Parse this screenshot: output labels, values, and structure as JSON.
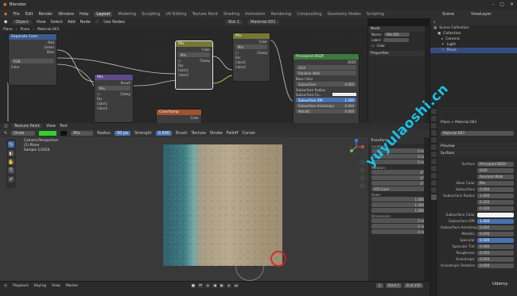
{
  "window": {
    "title": "Blender"
  },
  "menu": [
    "File",
    "Edit",
    "Render",
    "Window",
    "Help"
  ],
  "workspaces": [
    {
      "label": "Layout",
      "active": true
    },
    {
      "label": "Modeling"
    },
    {
      "label": "Sculpting"
    },
    {
      "label": "UV Editing"
    },
    {
      "label": "Texture Paint"
    },
    {
      "label": "Shading"
    },
    {
      "label": "Animation"
    },
    {
      "label": "Rendering"
    },
    {
      "label": "Compositing"
    },
    {
      "label": "Geometry Nodes"
    },
    {
      "label": "Scripting"
    }
  ],
  "top_right": {
    "scene": "Scene",
    "view_layer": "ViewLayer"
  },
  "node_header": {
    "object_mode": "Object",
    "view": "View",
    "select": "Select",
    "add": "Add",
    "node": "Node",
    "use_nodes": "Use Nodes",
    "slot": "Slot 1",
    "material": "Material.001"
  },
  "breadcrumb": {
    "obj": "Plane",
    "mesh": "Plane",
    "mat": "Material.003"
  },
  "nodes": {
    "separate_color": {
      "title": "Separate Color",
      "outputs": [
        "Red",
        "Green",
        "Blue"
      ],
      "mode": "RGB",
      "input": "Color"
    },
    "mix1": {
      "title": "Mix",
      "output": "Result",
      "type": "Mix",
      "clamp": "Clamp",
      "fac": "Fac",
      "c1": "Color1",
      "c2": "Color2"
    },
    "mix2": {
      "title": "Mix",
      "output": "Color",
      "type": "Mix",
      "clamp": "Clamp",
      "fac": "Fac",
      "c1": "Color1",
      "c2": "Color2"
    },
    "mix3": {
      "title": "Mix",
      "output": "Color",
      "type": "Mix",
      "clamp": "Clamp",
      "fac": "Fac",
      "c1": "Color1",
      "c2": "Color2"
    },
    "colorramp": {
      "title": "ColorRamp",
      "output": "Color"
    },
    "bsdf": {
      "title": "Principled BSDF",
      "output": "BSDF",
      "dist": "GGX",
      "sss": "Random Walk",
      "rows": [
        {
          "label": "Base Color"
        },
        {
          "label": "Subsurface",
          "value": "0.000"
        },
        {
          "label": "Subsurface Radius"
        },
        {
          "label": "Subsurface Co..."
        },
        {
          "label": "Subsurface IOR",
          "value": "1.400"
        },
        {
          "label": "Subsurface Anisotropy",
          "value": "0.000"
        },
        {
          "label": "Metallic",
          "value": "0.000"
        }
      ]
    }
  },
  "n_panel": {
    "section": "Node",
    "name_label": "Name:",
    "name_value": "Mix.001",
    "label_label": "Label:",
    "color_label": "Color",
    "properties_label": "Properties"
  },
  "outliner": {
    "header": "Scene Collection",
    "items": [
      {
        "label": "Scene Collection"
      },
      {
        "label": "Collection"
      },
      {
        "label": "Camera"
      },
      {
        "label": "Light"
      },
      {
        "label": "Plane",
        "selected": true
      }
    ]
  },
  "properties": {
    "crumb": "Plane  >  Material.003",
    "material": "Material.003",
    "preview": "Preview",
    "surface": "Surface",
    "rows": [
      {
        "label": "Surface",
        "value": "Principled BSDF"
      },
      {
        "label": "",
        "value": "GGX"
      },
      {
        "label": "",
        "value": "Random Walk"
      },
      {
        "label": "Base Color",
        "value": "Mix"
      },
      {
        "label": "Subsurface",
        "value": "0.000"
      },
      {
        "label": "Subsurface Radius",
        "value": "1.000"
      },
      {
        "label": "",
        "value": "0.200"
      },
      {
        "label": "",
        "value": "0.100"
      },
      {
        "label": "Subsurface Color",
        "value": "",
        "style": "white"
      },
      {
        "label": "Subsurface IOR",
        "value": "1.400",
        "style": "blue"
      },
      {
        "label": "Subsurface Anisotropy",
        "value": "0.000"
      },
      {
        "label": "Metallic",
        "value": "0.000"
      },
      {
        "label": "Specular",
        "value": "0.500",
        "style": "blue"
      },
      {
        "label": "Specular Tint",
        "value": "0.000"
      },
      {
        "label": "Roughness",
        "value": "0.500"
      },
      {
        "label": "Anisotropic",
        "value": "0.000"
      },
      {
        "label": "Anisotropic Rotation",
        "value": "0.000"
      }
    ]
  },
  "viewport": {
    "mode": "Texture Paint",
    "view": "View",
    "tool_menu": "Tool",
    "brush": "Draw",
    "blend": "Mix",
    "radius_label": "Radius",
    "radius_value": "50 px",
    "strength_label": "Strength",
    "strength_value": "0.500",
    "tabs": [
      "Brush",
      "Texture",
      "Stroke",
      "Falloff",
      "Cursor"
    ],
    "info_lines": [
      "Camera Perspective",
      "(1) Plane",
      "Sample 1/1024"
    ],
    "accent_color": "#2bd42b"
  },
  "transform": {
    "title": "Transform",
    "location_label": "Location:",
    "location": [
      "0 m",
      "0 m",
      "0 m"
    ],
    "rotation_label": "Rotation:",
    "rotation": [
      "0°",
      "0°",
      "0°"
    ],
    "rotation_mode": "XYZ Euler",
    "scale_label": "Scale:",
    "scale": [
      "1.000",
      "1.000",
      "1.000"
    ],
    "dimensions_label": "Dimensions:",
    "dimensions": [
      "2 m",
      "2 m",
      "0 m"
    ]
  },
  "timeline": {
    "playback": "Playback",
    "keying": "Keying",
    "view": "View",
    "marker": "Marker",
    "current": "1",
    "start_label": "Start",
    "start": "1",
    "end_label": "End",
    "end": "250"
  },
  "overlay": {
    "watermark": "yuyulaoshi.cn",
    "udemy": "Udemy"
  }
}
